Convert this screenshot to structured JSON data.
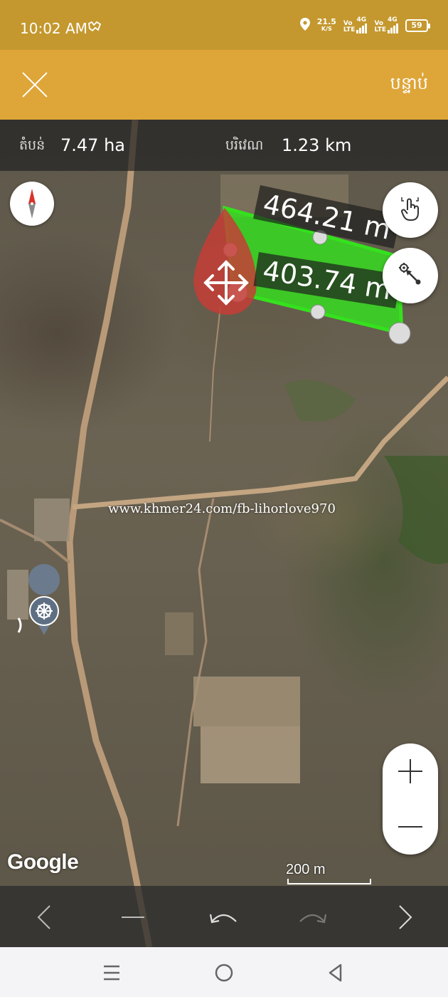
{
  "status_bar": {
    "time": "10:02 AM",
    "speed_value": "21.5",
    "speed_unit": "K/S",
    "net1_label": "Vo\nLTE",
    "net1_type": "4G",
    "net2_label": "Vo\nLTE",
    "net2_type": "4G",
    "battery": "59",
    "icons": [
      "notification-icon",
      "location-icon",
      "signal-icon",
      "battery-icon"
    ]
  },
  "app_bar": {
    "close_icon": "close-icon",
    "next_label": "បន្ទាប់"
  },
  "info": {
    "area_label": "តំបន់",
    "area_value": "7.47 ha",
    "perimeter_label": "បរិវេណ",
    "perimeter_value": "1.23 km"
  },
  "map": {
    "distance_top": "464.21 m",
    "distance_middle": "403.74 m",
    "watermark": "www.khmer24.com/fb-lihorlove970",
    "logo": "Google",
    "scale": "200 m",
    "polygon_color": "#35e11e",
    "marker_color": "#c43d36"
  },
  "controls": {
    "compass_icon": "compass-icon",
    "touch_icon": "hand-pointer-icon",
    "select_icon": "point-select-icon",
    "zoom_in_icon": "plus-icon",
    "zoom_out_icon": "minus-icon"
  },
  "toolbar": {
    "items": [
      "chevron-left-icon",
      "minus-icon",
      "undo-icon",
      "redo-icon",
      "chevron-right-icon"
    ]
  },
  "nav_bar": {
    "items": [
      "menu-icon",
      "home-icon",
      "back-icon"
    ]
  }
}
